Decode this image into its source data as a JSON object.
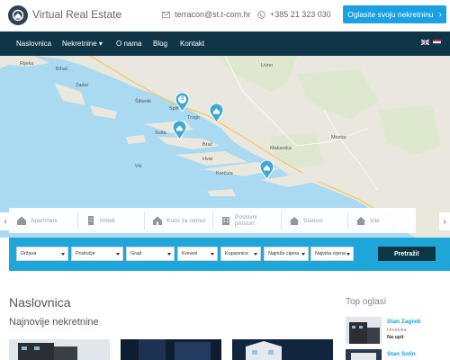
{
  "header": {
    "brand": "Virtual Real Estate",
    "email": "terracon@st.t-com.hr",
    "phone": "+385 21 323 030",
    "cta": "Oglasite svoju nekretninu",
    "cta_arrow": "›"
  },
  "nav": {
    "items": [
      {
        "label": "Naslovnica"
      },
      {
        "label": "Nekretnine ▾"
      },
      {
        "label": "O nama"
      },
      {
        "label": "Blog"
      },
      {
        "label": "Kontakt"
      }
    ]
  },
  "map": {
    "labels": [
      "Rijeka",
      "Zadar",
      "Šibenik",
      "Split",
      "Makarska",
      "Mostar",
      "Hvar",
      "Vis",
      "Brač",
      "Solta",
      "Korčula",
      "Bihać",
      "Livno",
      "Trogir"
    ],
    "pin_count": "3",
    "sea_color": "#aadaf2",
    "land_color": "#eae7df",
    "pin_color": "#3fa9d6"
  },
  "categories": [
    {
      "label": "Apartmani",
      "icon": "house-icon"
    },
    {
      "label": "Hoteli",
      "icon": "building-icon"
    },
    {
      "label": "Kuće za odmor",
      "icon": "house-icon"
    },
    {
      "label": "Poslovni prostori",
      "icon": "office-icon"
    },
    {
      "label": "Stanovi",
      "icon": "roof-icon"
    },
    {
      "label": "Vile",
      "icon": "roof-icon"
    }
  ],
  "arrows": {
    "prev": "‹",
    "next": "›"
  },
  "search": {
    "filters": [
      "Država",
      "Područje",
      "Grad",
      "Kreveti",
      "Kupaonice",
      "Najniža cijena",
      "Najviša cijena"
    ],
    "button": "Pretraži!"
  },
  "content": {
    "page_title": "Naslovnica",
    "section_title": "Najnovije nekretnine"
  },
  "top_ads": {
    "title": "Top oglasi",
    "items": [
      {
        "title": "Stan Zagreb",
        "region": "Hrvatska",
        "price": "Na upit"
      },
      {
        "title": "Stan Solin",
        "region": "",
        "price": ""
      }
    ]
  },
  "colors": {
    "navbar": "#0f3647",
    "accent": "#1ba1e2",
    "searchbar": "#1fa6d8"
  }
}
